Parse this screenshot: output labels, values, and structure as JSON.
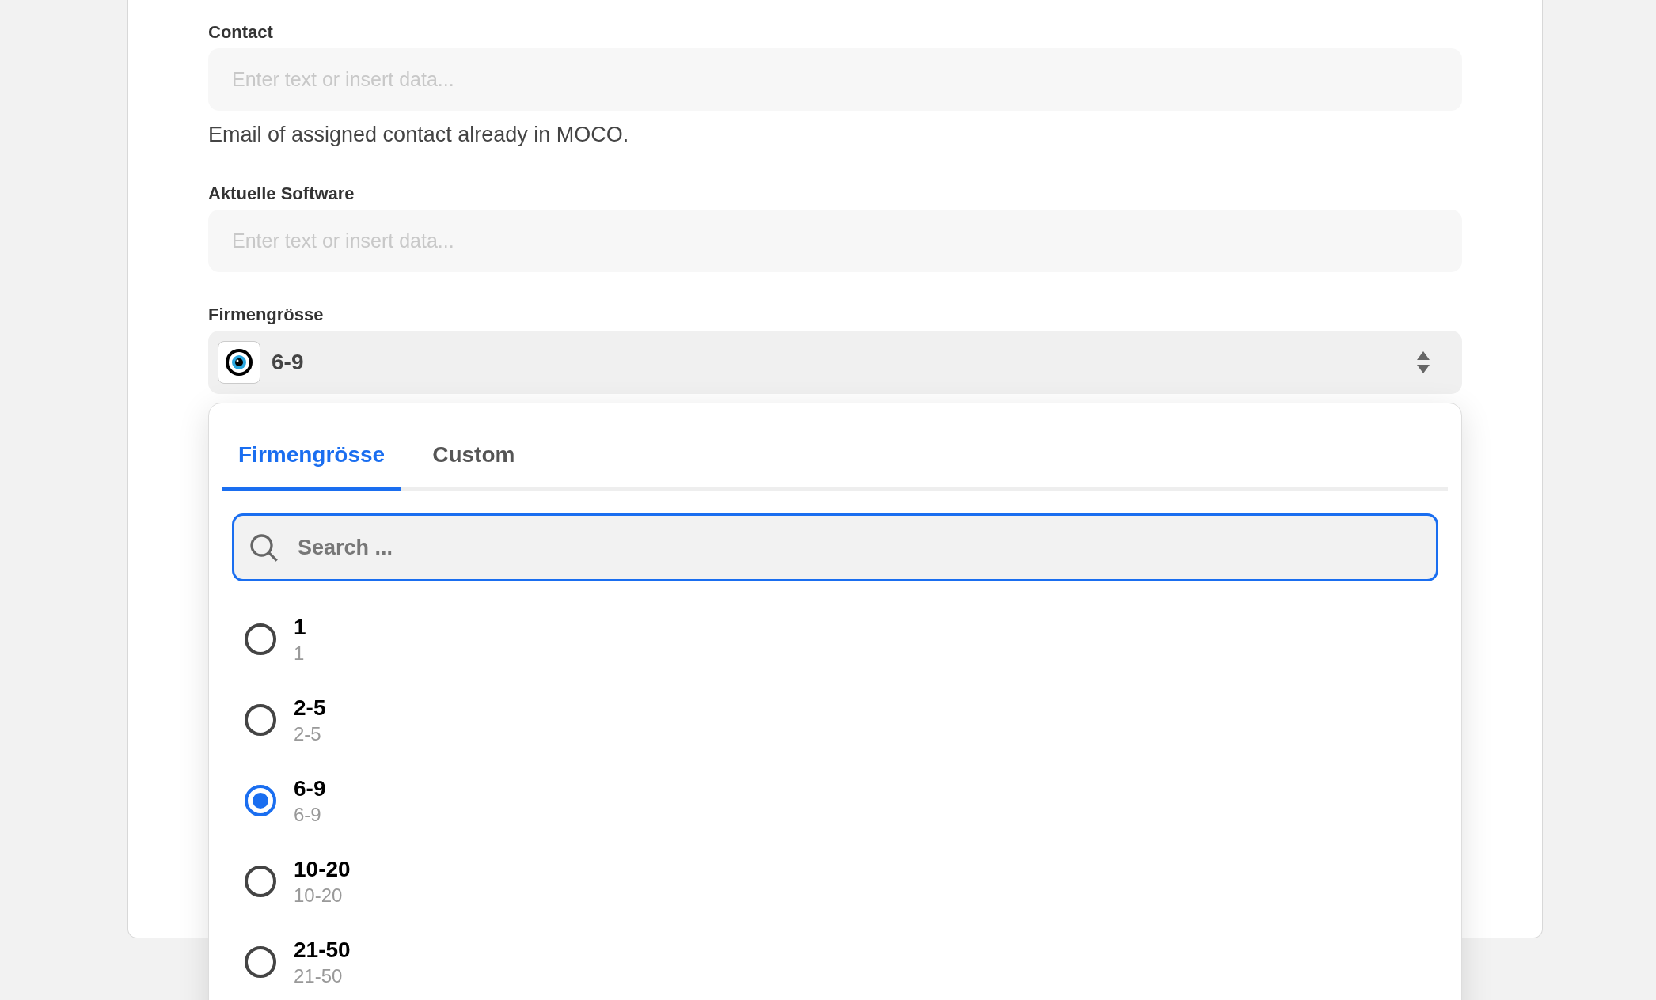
{
  "fields": [
    {
      "label": "Contact",
      "placeholder": "Enter text or insert data...",
      "help": "Email of assigned contact already in MOCO."
    },
    {
      "label": "Aktuelle Software",
      "placeholder": "Enter text or insert data..."
    }
  ],
  "select": {
    "label": "Firmengrösse",
    "value": "6-9"
  },
  "dropdown": {
    "tabs": [
      {
        "label": "Firmengrösse",
        "selected": true
      },
      {
        "label": "Custom",
        "selected": false
      }
    ],
    "search": {
      "placeholder": "Search ..."
    },
    "options": [
      {
        "title": "1",
        "subtitle": "1",
        "selected": false
      },
      {
        "title": "2-5",
        "subtitle": "2-5",
        "selected": false
      },
      {
        "title": "6-9",
        "subtitle": "6-9",
        "selected": true
      },
      {
        "title": "10-20",
        "subtitle": "10-20",
        "selected": false
      },
      {
        "title": "21-50",
        "subtitle": "21-50",
        "selected": false
      }
    ]
  }
}
